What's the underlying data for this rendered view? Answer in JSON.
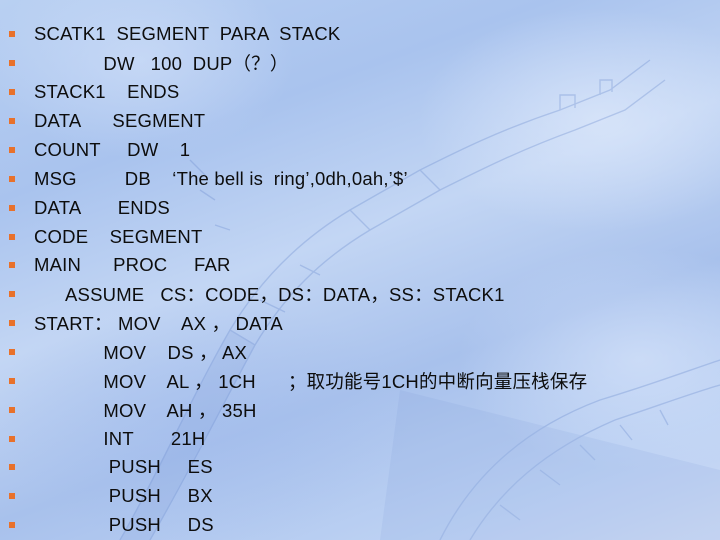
{
  "slide": {
    "bullet_color": "#e8712b",
    "lines": [
      {
        "text": "SCATK1  SEGMENT  PARA  STACK"
      },
      {
        "text": "             DW   100  DUP（？）"
      },
      {
        "text": "STACK1    ENDS"
      },
      {
        "text": "DATA      SEGMENT"
      },
      {
        "text": "COUNT     DW    1"
      },
      {
        "text": "MSG         DB    ‘The bell is  ring’,0dh,0ah,’$’"
      },
      {
        "text": "DATA       ENDS"
      },
      {
        "text": "CODE    SEGMENT"
      },
      {
        "text": "MAIN      PROC     FAR"
      },
      {
        "text": "      ASSUME   CS：CODE，DS：DATA，SS：STACK1"
      },
      {
        "text": "START： MOV    AX ， DATA"
      },
      {
        "text": "             MOV    DS ， AX"
      },
      {
        "text": "             MOV    AL ， 1CH      ；取功能号1CH的中断向量压栈保存"
      },
      {
        "text": "             MOV    AH ， 35H"
      },
      {
        "text": "             INT       21H"
      },
      {
        "text": "              PUSH     ES"
      },
      {
        "text": "              PUSH     BX"
      },
      {
        "text": "              PUSH     DS"
      }
    ]
  }
}
